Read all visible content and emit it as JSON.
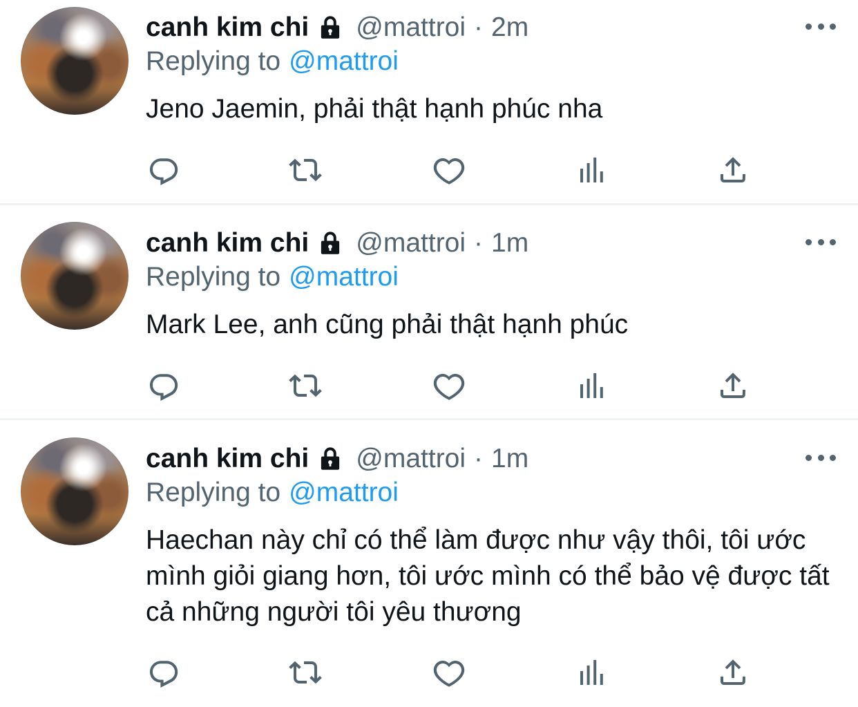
{
  "tweets": [
    {
      "display_name": "canh kim chi",
      "handle": "@mattroi",
      "separator": "·",
      "time": "2m",
      "replying_prefix": "Replying to",
      "replying_to": "@mattroi",
      "text": "Jeno Jaemin, phải thật hạnh phúc nha"
    },
    {
      "display_name": "canh kim chi",
      "handle": "@mattroi",
      "separator": "·",
      "time": "1m",
      "replying_prefix": "Replying to",
      "replying_to": "@mattroi",
      "text": "Mark Lee, anh cũng phải thật hạnh phúc"
    },
    {
      "display_name": "canh kim chi",
      "handle": "@mattroi",
      "separator": "·",
      "time": "1m",
      "replying_prefix": "Replying to",
      "replying_to": "@mattroi",
      "text": "Haechan này chỉ có thể làm được như vậy thôi, tôi ước mình giỏi giang hơn, tôi ước mình có thể bảo vệ được tất cả những người tôi yêu thương"
    }
  ],
  "icons": {
    "lock": "lock-icon",
    "more": "more-horizontal-icon",
    "reply": "reply-icon",
    "retweet": "retweet-icon",
    "like": "heart-icon",
    "analytics": "analytics-icon",
    "share": "share-icon"
  },
  "colors": {
    "text_primary": "#0f1419",
    "text_secondary": "#536471",
    "link": "#1d9bf0",
    "divider": "#eff3f4"
  }
}
